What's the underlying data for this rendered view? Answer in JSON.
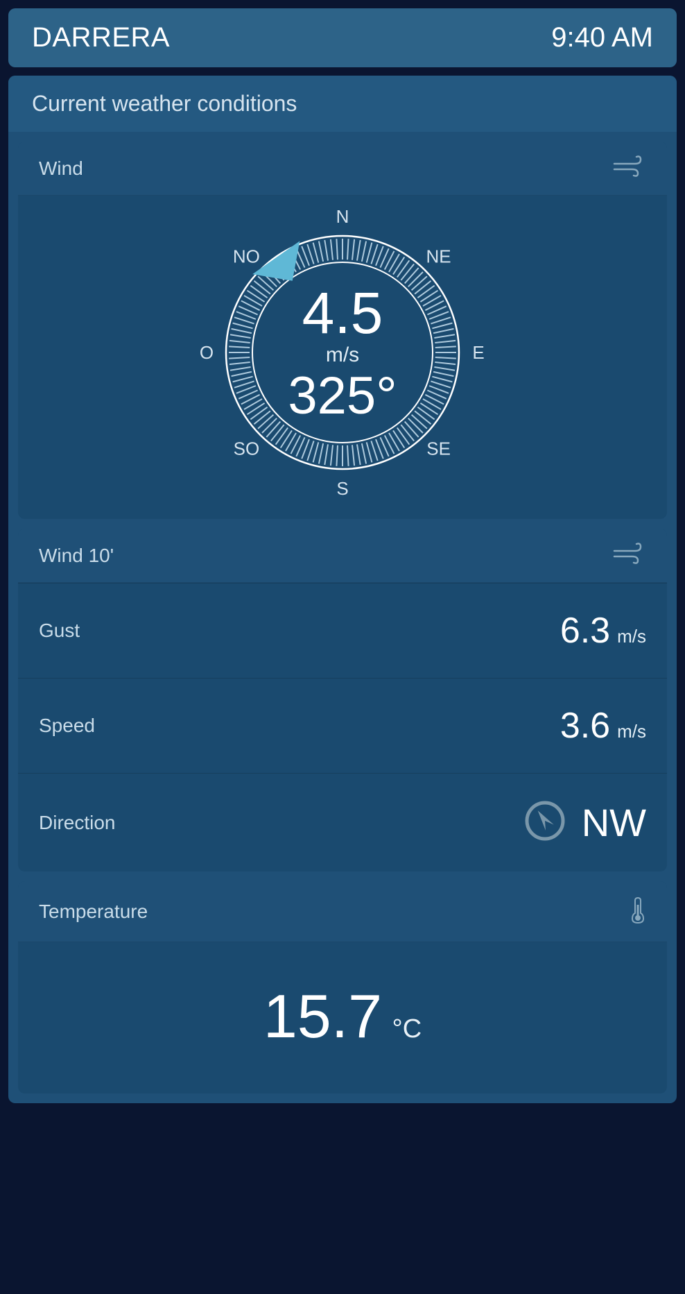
{
  "header": {
    "station_name": "DARRERA",
    "time": "9:40 AM"
  },
  "section": {
    "title": "Current weather conditions"
  },
  "wind": {
    "title": "Wind",
    "speed": "4.5",
    "speed_unit": "m/s",
    "direction_deg": "325°",
    "direction_num": 325,
    "compass_labels": {
      "n": "N",
      "ne": "NE",
      "e": "E",
      "se": "SE",
      "s": "S",
      "so": "SO",
      "o": "O",
      "no": "NO"
    }
  },
  "wind10": {
    "title": "Wind 10'",
    "gust_label": "Gust",
    "gust_value": "6.3",
    "gust_unit": "m/s",
    "speed_label": "Speed",
    "speed_value": "3.6",
    "speed_unit": "m/s",
    "direction_label": "Direction",
    "direction_value": "NW",
    "direction_num": 325
  },
  "temperature": {
    "title": "Temperature",
    "value": "15.7",
    "unit": "°C"
  }
}
